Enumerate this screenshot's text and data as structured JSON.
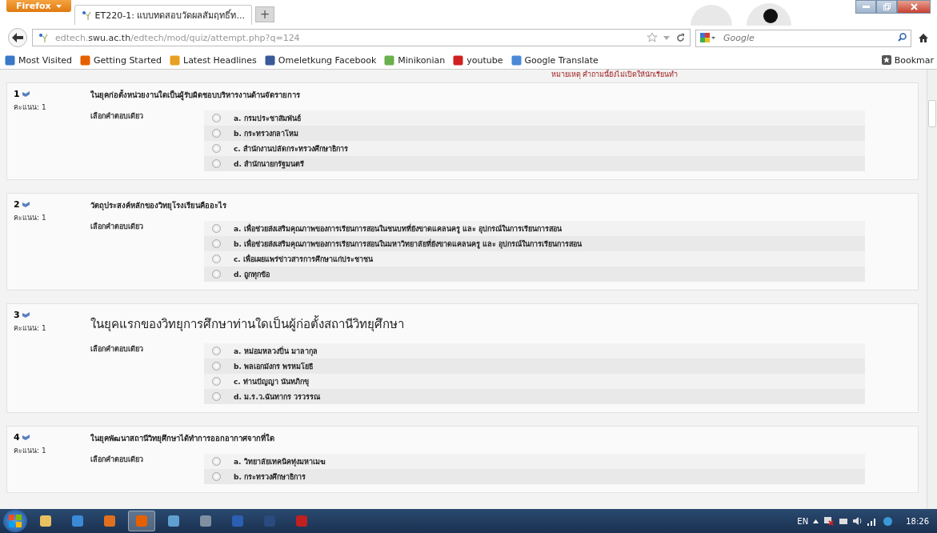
{
  "browser": {
    "menu_button": "Firefox",
    "tabs": [
      {
        "title": "ET220-1: แบบทดสอบวัดผลสัมฤทธิ์ท...",
        "selected": true
      }
    ],
    "new_tab": "+",
    "url": {
      "subdomain": "edtech.",
      "domain": "swu.ac.th",
      "path": "/edtech/mod/quiz/attempt.php?q=124"
    },
    "search": {
      "placeholder": "Google"
    },
    "bookmarks": [
      {
        "label": "Most Visited"
      },
      {
        "label": "Getting Started"
      },
      {
        "label": "Latest Headlines"
      },
      {
        "label": "Omeletkung Facebook"
      },
      {
        "label": "Minikonian"
      },
      {
        "label": "youtube"
      },
      {
        "label": "Google Translate"
      }
    ],
    "bookmarks_menu": "Bookmar"
  },
  "note": "หมายเหตุ คำถามนี้ยังไม่เปิดให้นักเรียนทำ",
  "questions": [
    {
      "number": "1",
      "score": "คะแนน: 1",
      "text": "ในยุคก่อตั้งหน่วยงานใดเป็นผู้รับผิดชอบบริหารงานด้านจัดรายการ",
      "large": false,
      "prompt": "เลือกคำตอบเดียว",
      "options": [
        {
          "label": "a. กรมประชาสัมพันธ์",
          "selected": false
        },
        {
          "label": "b. กระทรวงกลาโหม",
          "selected": false
        },
        {
          "label": "c. สำนักงานปลัดกระทรวงศึกษาธิการ",
          "selected": false
        },
        {
          "label": "d. สำนักนายกรัฐมนตรี",
          "selected": false
        }
      ]
    },
    {
      "number": "2",
      "score": "คะแนน: 1",
      "text": "วัตถุประสงค์หลักของวิทยุโรงเรียนคืออะไร",
      "large": false,
      "prompt": "เลือกคำตอบเดียว",
      "options": [
        {
          "label": "a. เพื่อช่วยส่งเสริมคุณภาพของการเรียนการสอนในชนบทที่ยังขาดแคลนครู และ อุปกรณ์ในการเรียนการสอน",
          "selected": false
        },
        {
          "label": "b. เพื่อช่วยส่งเสริมคุณภาพของการเรียนการสอนในมหาวิทยาลัยที่ยังขาดแคลนครู และ อุปกรณ์ในการเรียนการสอน",
          "selected": false
        },
        {
          "label": "c. เพื่อเผยแพร่ข่าวสารการศึกษาแก่ประชาชน",
          "selected": false
        },
        {
          "label": "d. ถูกทุกข้อ",
          "selected": false
        }
      ]
    },
    {
      "number": "3",
      "score": "คะแนน: 1",
      "text": "ในยุคแรกของวิทยุการศึกษาท่านใดเป็นผู้ก่อตั้งสถานีวิทยุศึกษา",
      "large": true,
      "prompt": "เลือกคำตอบเดียว",
      "options": [
        {
          "label": "a. หม่อมหลวงปิ่น มาลากุล",
          "selected": false
        },
        {
          "label": "b. พลเอกมังกร พรหมโยธี",
          "selected": false
        },
        {
          "label": "c. ท่านปัญญา นันทภิกขุ",
          "selected": false
        },
        {
          "label": "d. ม.ร.ว.ฉันทากร วรวรรณ",
          "selected": false
        }
      ]
    },
    {
      "number": "4",
      "score": "คะแนน: 1",
      "text": "ในยุคพัฒนาสถานีวิทยุศึกษาได้ทำการออกอากาศจากที่ใด",
      "large": false,
      "prompt": "เลือกคำตอบเดียว",
      "options": [
        {
          "label": "a. วิทยาลัยเทคนิคทุ่งมหาเมฆ",
          "selected": false
        },
        {
          "label": "b. กระทรวงศึกษาธิการ",
          "selected": false
        }
      ]
    }
  ],
  "taskbar": {
    "apps": [
      {
        "selected": false
      },
      {
        "selected": false
      },
      {
        "selected": false
      },
      {
        "selected": true
      },
      {
        "selected": false
      },
      {
        "selected": false
      },
      {
        "selected": false
      },
      {
        "selected": false
      },
      {
        "selected": false
      }
    ],
    "language": "EN",
    "clock": "18:26"
  }
}
